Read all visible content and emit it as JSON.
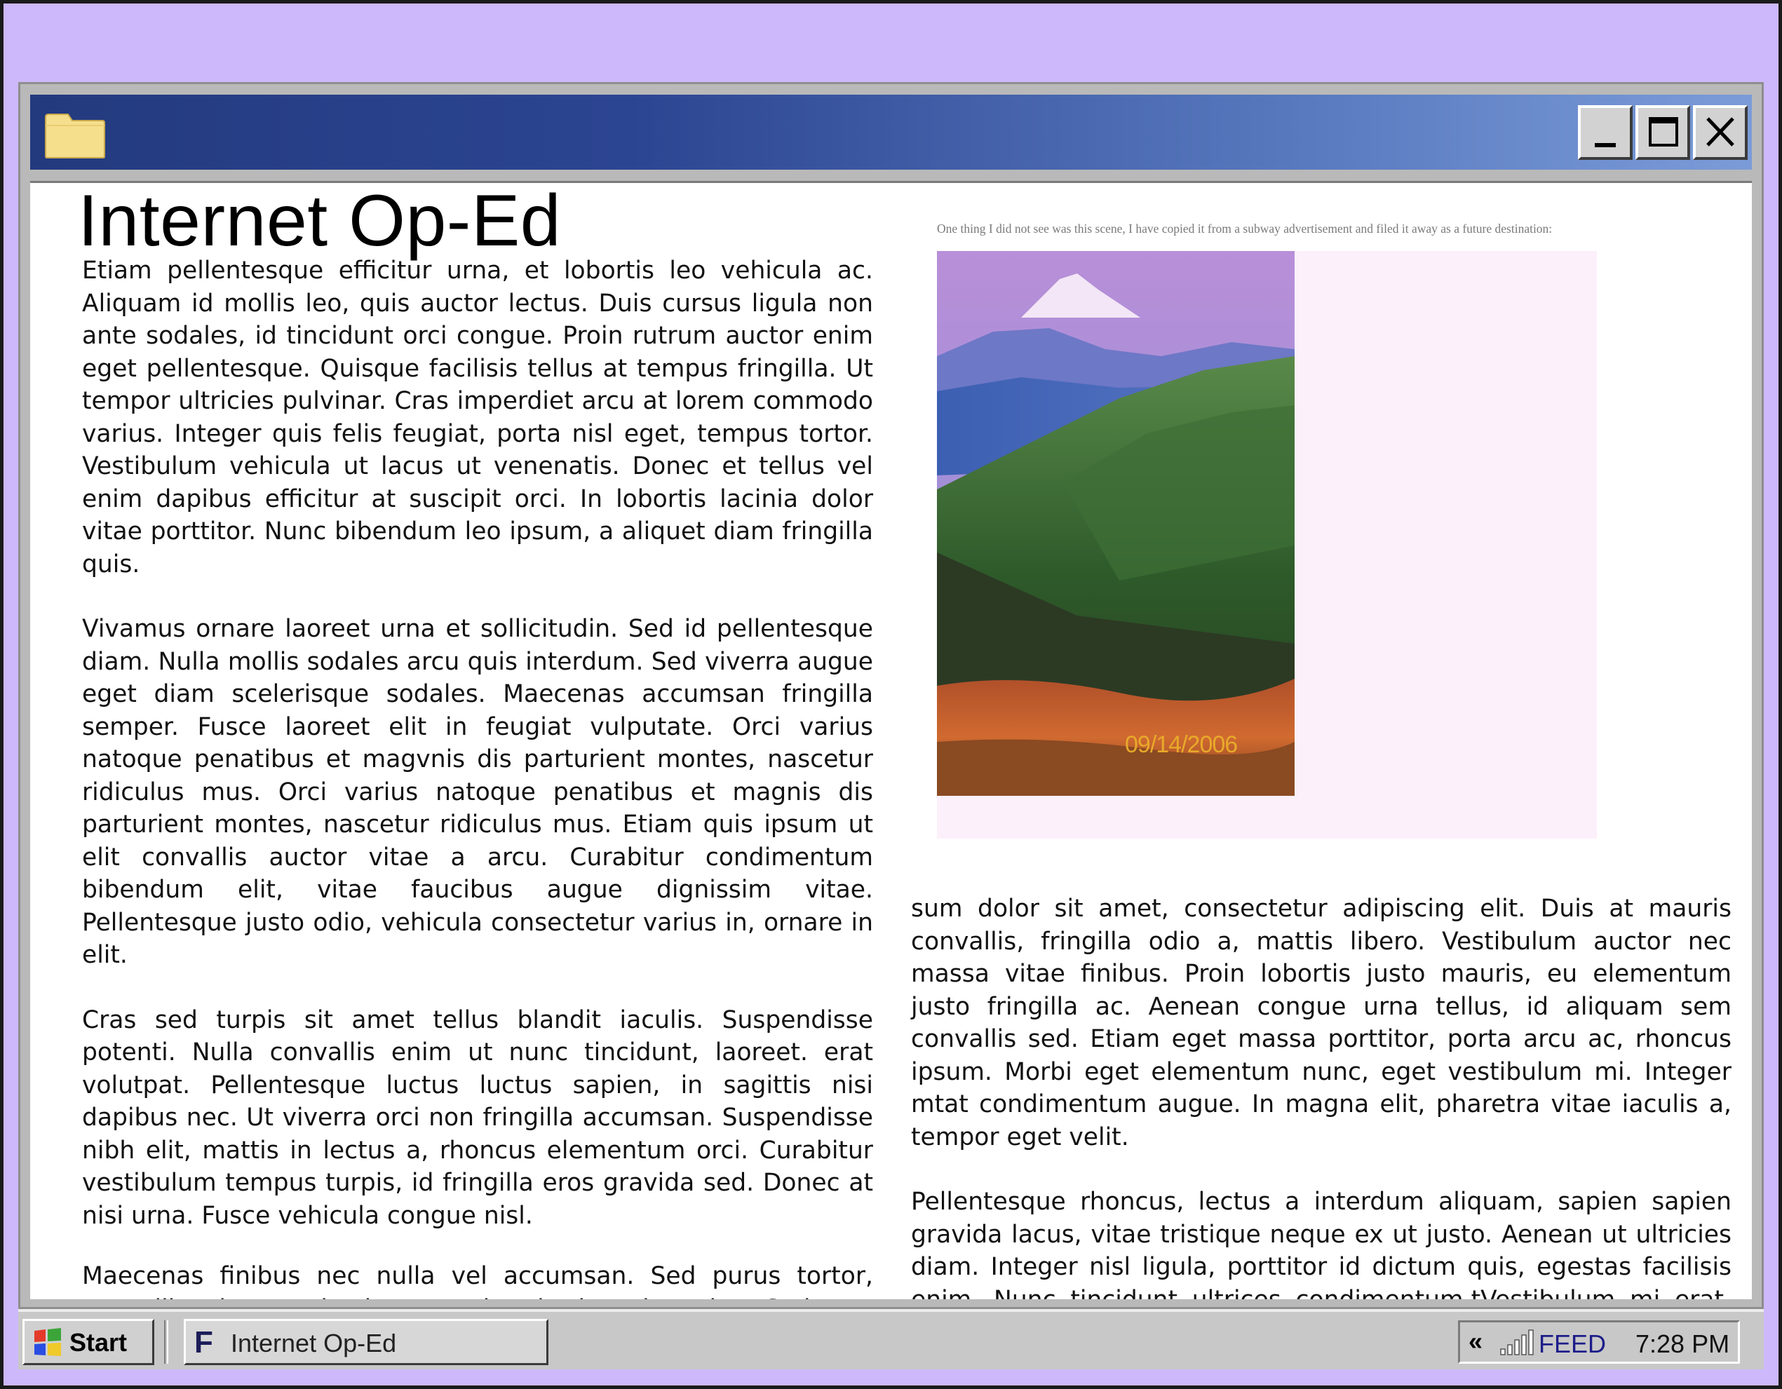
{
  "window": {
    "title": "",
    "icon": "folder-icon",
    "controls": {
      "minimize": "minimize-icon",
      "maximize": "maximize-icon",
      "close": "close-icon"
    }
  },
  "article": {
    "headline": "Internet Op-Ed",
    "left_paragraphs": [
      "Etiam pellentesque efficitur urna, et lobortis leo vehicula ac. Aliquam id mollis leo, quis auctor lectus. Duis cursus ligula non ante sodales, id tincidunt orci congue. Proin rutrum auctor enim eget pellentesque. Quisque facilisis tellus at tempus fringilla. Ut tempor ultricies pulvinar. Cras imperdiet arcu at lorem commodo varius. Integer quis felis feugiat, porta nisl eget, tempus tortor. Vestibulum vehicula ut lacus ut venenatis. Donec et tellus vel enim dapibus efficitur at suscipit orci. In lobortis lacinia dolor vitae porttitor. Nunc bibendum leo ipsum, a aliquet diam fringilla quis.",
      "Vivamus ornare laoreet urna et sollicitudin. Sed id pellentesque diam. Nulla mollis sodales arcu quis interdum. Sed viverra augue eget diam scelerisque sodales. Maecenas accumsan fringilla semper. Fusce laoreet elit in feugiat vulputate. Orci varius natoque penatibus et magvnis dis parturient montes, nascetur ridiculus mus. Orci varius natoque penatibus et magnis dis parturient montes, nascetur ridiculus mus. Etiam quis ipsum ut elit convallis auctor vitae a arcu. Curabitur condimentum bibendum elit, vitae faucibus augue dignissim vitae. Pellentesque justo odio, vehicula consectetur varius in, ornare in elit.",
      "Cras sed turpis sit amet tellus blandit iaculis. Suspendisse potenti. Nulla convallis enim ut nunc tincidunt, laoreet. erat volutpat. Pellentesque luctus luctus sapien, in sagittis nisi dapibus nec. Ut viverra orci non fringilla accumsan. Suspendisse nibh elit, mattis in lectus a, rhoncus elementum orci. Curabitur vestibulum tempus turpis, id fringilla eros gravida sed. Donec at nisi urna. Fusce vehicula congue nisl.",
      "Maecenas finibus nec nulla vel accumsan. Sed purus tortor, convallis vitae molestie eget, hendrerit quis enim. Sed non metus ut quam iaculis lacinia. Maecenas justo felis. pulvinar eget faucibus non, pulvinar eu erat. Vivamus suscip-"
    ],
    "right_paragraphs": [
      "sum dolor sit amet, consectetur adipiscing elit. Duis at mauris convallis, fringilla odio a, mattis libero. Vestibulum auctor nec massa vitae finibus. Proin lobortis justo mauris, eu elementum justo fringilla ac. Aenean congue urna tellus, id aliquam sem convallis sed. Etiam eget massa porttitor, porta arcu ac, rhoncus ipsum. Morbi eget elementum nunc, eget vestibulum mi. Integer mtat condimentum augue. In magna elit, pharetra vitae iaculis a, tempor eget velit.",
      "Pellentesque rhoncus, lectus a interdum aliquam, sapien sapien gravida lacus, vitae tristique neque ex ut justo. Aenean ut ultricies diam. Integer nisl ligula, porttitor id dictum quis, egestas facilisis enim. Nunc tincidunt ultrices condimentum.tVestibulum mi erat, vestibulum nec dictum eu, iaculis at nulla. Vestibulum et auctor est. Aliquam venenatis, massa in feugiat elementum, id lectus."
    ],
    "photo": {
      "caption": "One thing I did not see was this scene, I have copied it from a subway advertisement and filed it away as a future destination:",
      "date_stamp": "09/14/2006"
    }
  },
  "taskbar": {
    "start_label": "Start",
    "task_icon_letter": "F",
    "task_label": "Internet Op-Ed",
    "tray_chevron": "«",
    "tray_feed": "FEED",
    "clock": "7:28 PM"
  },
  "colors": {
    "desktop": "#cdb8fb",
    "titlebar_start": "#233a7e",
    "titlebar_end": "#7b9bd8",
    "chrome": "#c8c8c8",
    "date_stamp": "#e8a92a",
    "feed_text": "#1d1d8a"
  }
}
